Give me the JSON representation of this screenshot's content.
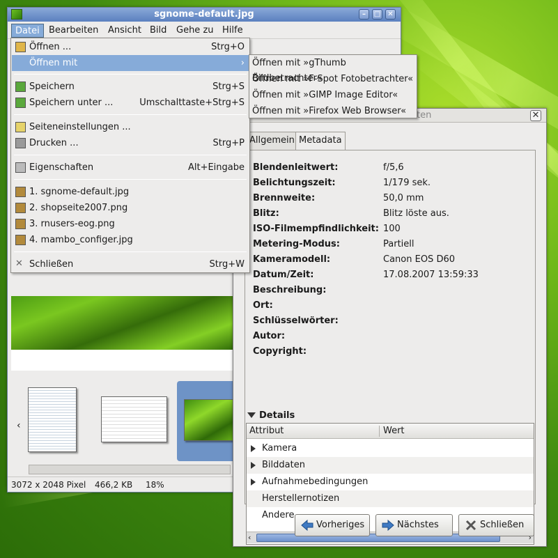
{
  "main_window": {
    "title": "sgnome-default.jpg",
    "menu": [
      "Datei",
      "Bearbeiten",
      "Ansicht",
      "Bild",
      "Gehe zu",
      "Hilfe"
    ],
    "status": {
      "dimensions": "3072 x 2048 Pixel",
      "size": "466,2 KB",
      "zoom": "18%"
    }
  },
  "file_menu": {
    "items": [
      {
        "label": "Öffnen ...",
        "accel": "Strg+O",
        "icon": "folder-icon"
      },
      {
        "label": "Öffnen mit",
        "accel": "›",
        "icon": ""
      },
      {
        "label": "Speichern",
        "accel": "Strg+S",
        "icon": "save-icon"
      },
      {
        "label": "Speichern unter ...",
        "accel": "Umschalttaste+Strg+S",
        "icon": "save-as-icon"
      },
      {
        "label": "Seiteneinstellungen ...",
        "accel": "",
        "icon": "page-setup-icon"
      },
      {
        "label": "Drucken ...",
        "accel": "Strg+P",
        "icon": "printer-icon"
      },
      {
        "label": "Eigenschaften",
        "accel": "Alt+Eingabe",
        "icon": "properties-icon"
      },
      {
        "label": "1. sgnome-default.jpg",
        "accel": "",
        "icon": "image-file-icon"
      },
      {
        "label": "2. shopseite2007.png",
        "accel": "",
        "icon": "image-file-icon"
      },
      {
        "label": "3. rnusers-eog.png",
        "accel": "",
        "icon": "image-file-icon"
      },
      {
        "label": "4. mambo_configer.jpg",
        "accel": "",
        "icon": "image-file-icon"
      },
      {
        "label": "Schließen",
        "accel": "Strg+W",
        "icon": "close-icon"
      }
    ]
  },
  "open_with_submenu": [
    "Öffnen mit »gThumb Bildbetrachter«",
    "Öffnen mit »F-Spot Fotobetrachter«",
    "Öffnen mit »GIMP Image Editor«",
    "Öffnen mit »Firefox Web Browser«"
  ],
  "dialog": {
    "title_fragment": "ten",
    "tabs": [
      "Allgemein",
      "Metadata"
    ],
    "metadata": [
      {
        "key": "Blendenleitwert:",
        "value": "f/5,6"
      },
      {
        "key": "Belichtungszeit:",
        "value": "1/179 sek."
      },
      {
        "key": "Brennweite:",
        "value": "50,0 mm"
      },
      {
        "key": "Blitz:",
        "value": "Blitz löste aus."
      },
      {
        "key": "ISO-Filmempfindlichkeit:",
        "value": "100"
      },
      {
        "key": "Metering-Modus:",
        "value": "Partiell"
      },
      {
        "key": "Kameramodell:",
        "value": "Canon EOS D60"
      },
      {
        "key": "Datum/Zeit:",
        "value": "17.08.2007 13:59:33"
      },
      {
        "key": "Beschreibung:",
        "value": ""
      },
      {
        "key": "Ort:",
        "value": ""
      },
      {
        "key": "Schlüsselwörter:",
        "value": ""
      },
      {
        "key": "Autor:",
        "value": ""
      },
      {
        "key": "Copyright:",
        "value": ""
      }
    ],
    "details_label": "Details",
    "columns": [
      "Attribut",
      "Wert"
    ],
    "tree": [
      {
        "label": "Kamera",
        "expandable": true
      },
      {
        "label": "Bilddaten",
        "expandable": true
      },
      {
        "label": "Aufnahmebedingungen",
        "expandable": true
      },
      {
        "label": "Herstellernotizen",
        "expandable": false
      },
      {
        "label": "Andere",
        "expandable": false
      }
    ],
    "buttons": {
      "previous": "Vorheriges",
      "next": "Nächstes",
      "close": "Schließen"
    }
  }
}
